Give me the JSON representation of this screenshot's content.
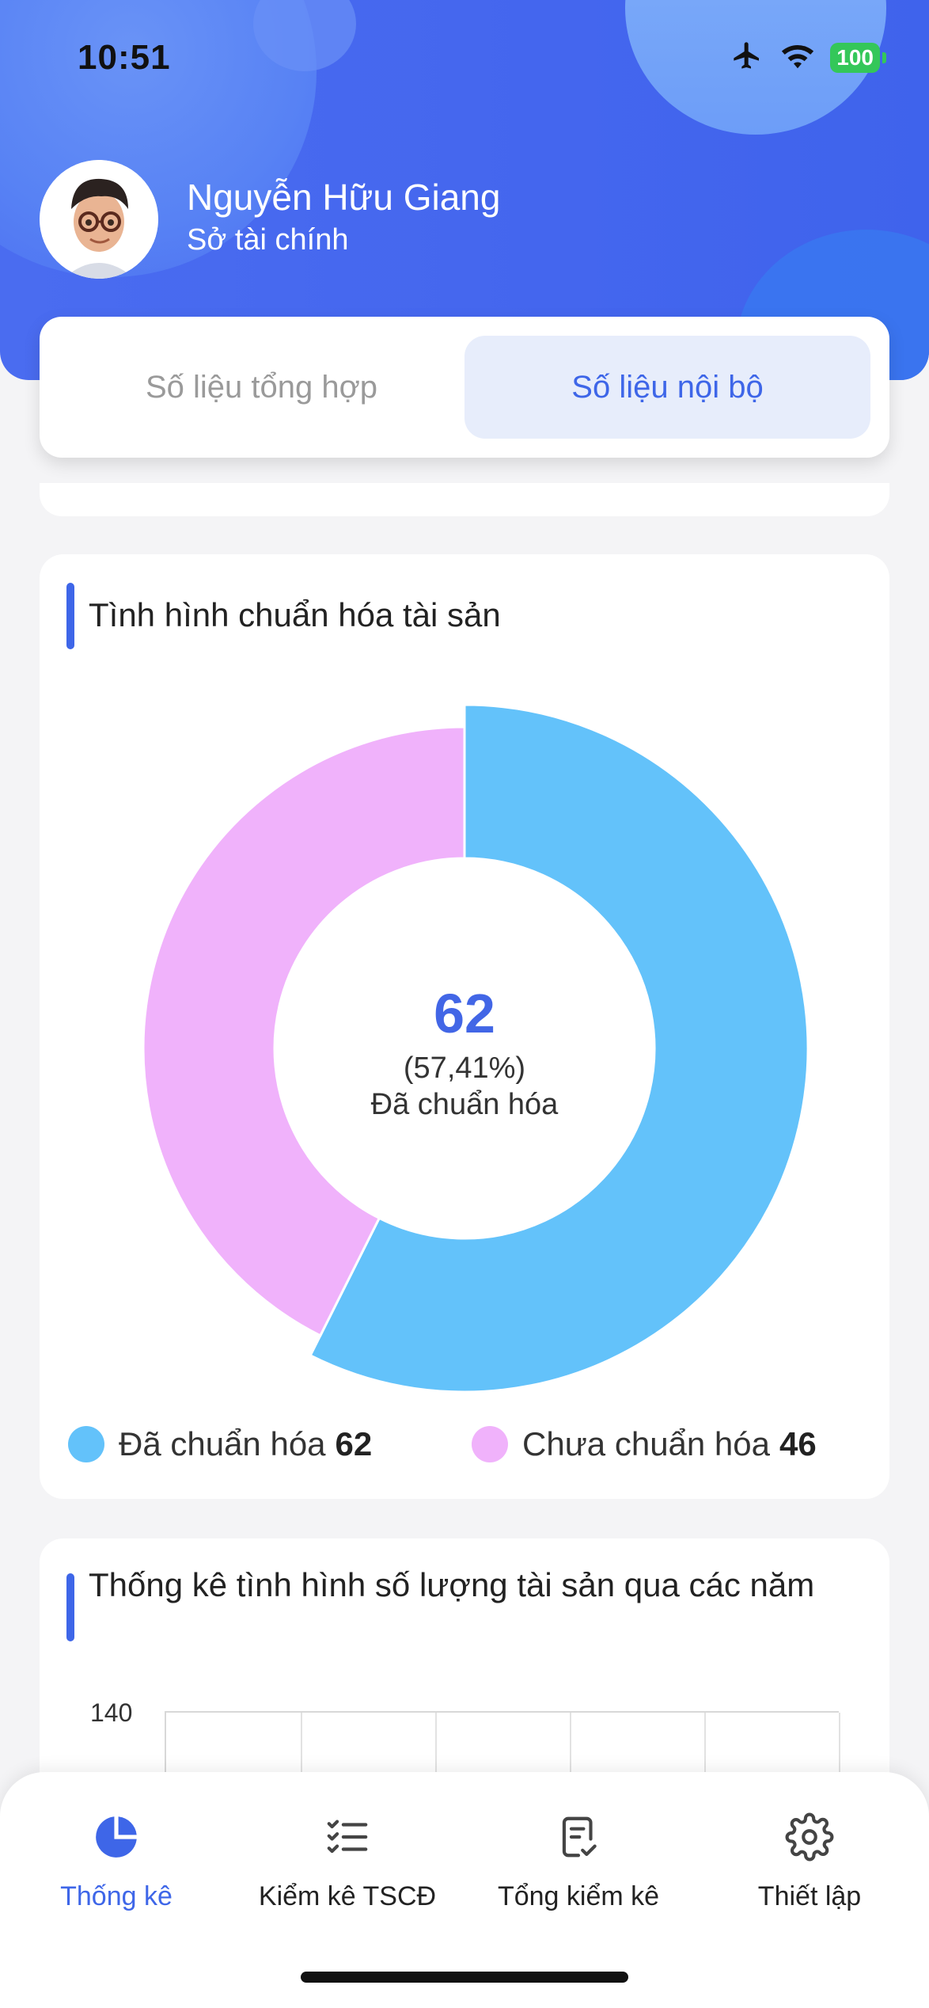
{
  "status_bar": {
    "time": "10:51",
    "battery": "100"
  },
  "profile": {
    "name": "Nguyễn Hữu Giang",
    "organization": "Sở tài chính"
  },
  "segment": {
    "tabs": [
      "Số liệu tổng hợp",
      "Số liệu nội bộ"
    ],
    "selected_index": 1
  },
  "card_standardization": {
    "title": "Tình hình chuẩn hóa tài sản",
    "center_value": "62",
    "center_percent": "(57,41%)",
    "center_label": "Đã chuẩn hóa",
    "legend": [
      {
        "label": "Đã chuẩn hóa",
        "value": "62",
        "color": "#63c2fa"
      },
      {
        "label": "Chưa chuẩn hóa",
        "value": "46",
        "color": "#f0b2fb"
      }
    ]
  },
  "chart_data": {
    "type": "pie",
    "categories": [
      "Đã chuẩn hóa",
      "Chưa chuẩn hóa"
    ],
    "values": [
      62,
      46
    ],
    "colors": [
      "#63c2fa",
      "#f0b2fb"
    ],
    "title": "Tình hình chuẩn hóa tài sản"
  },
  "card_yearly": {
    "title": "Thống kê tình hình số lượng tài sản qua các năm",
    "y_top_tick": "140"
  },
  "tab_bar": {
    "items": [
      {
        "label": "Thống kê",
        "icon": "pie-chart-icon",
        "active": true
      },
      {
        "label": "Kiểm kê TSCĐ",
        "icon": "checklist-icon",
        "active": false
      },
      {
        "label": "Tổng kiểm kê",
        "icon": "document-check-icon",
        "active": false
      },
      {
        "label": "Thiết lập",
        "icon": "gear-icon",
        "active": false
      }
    ]
  }
}
